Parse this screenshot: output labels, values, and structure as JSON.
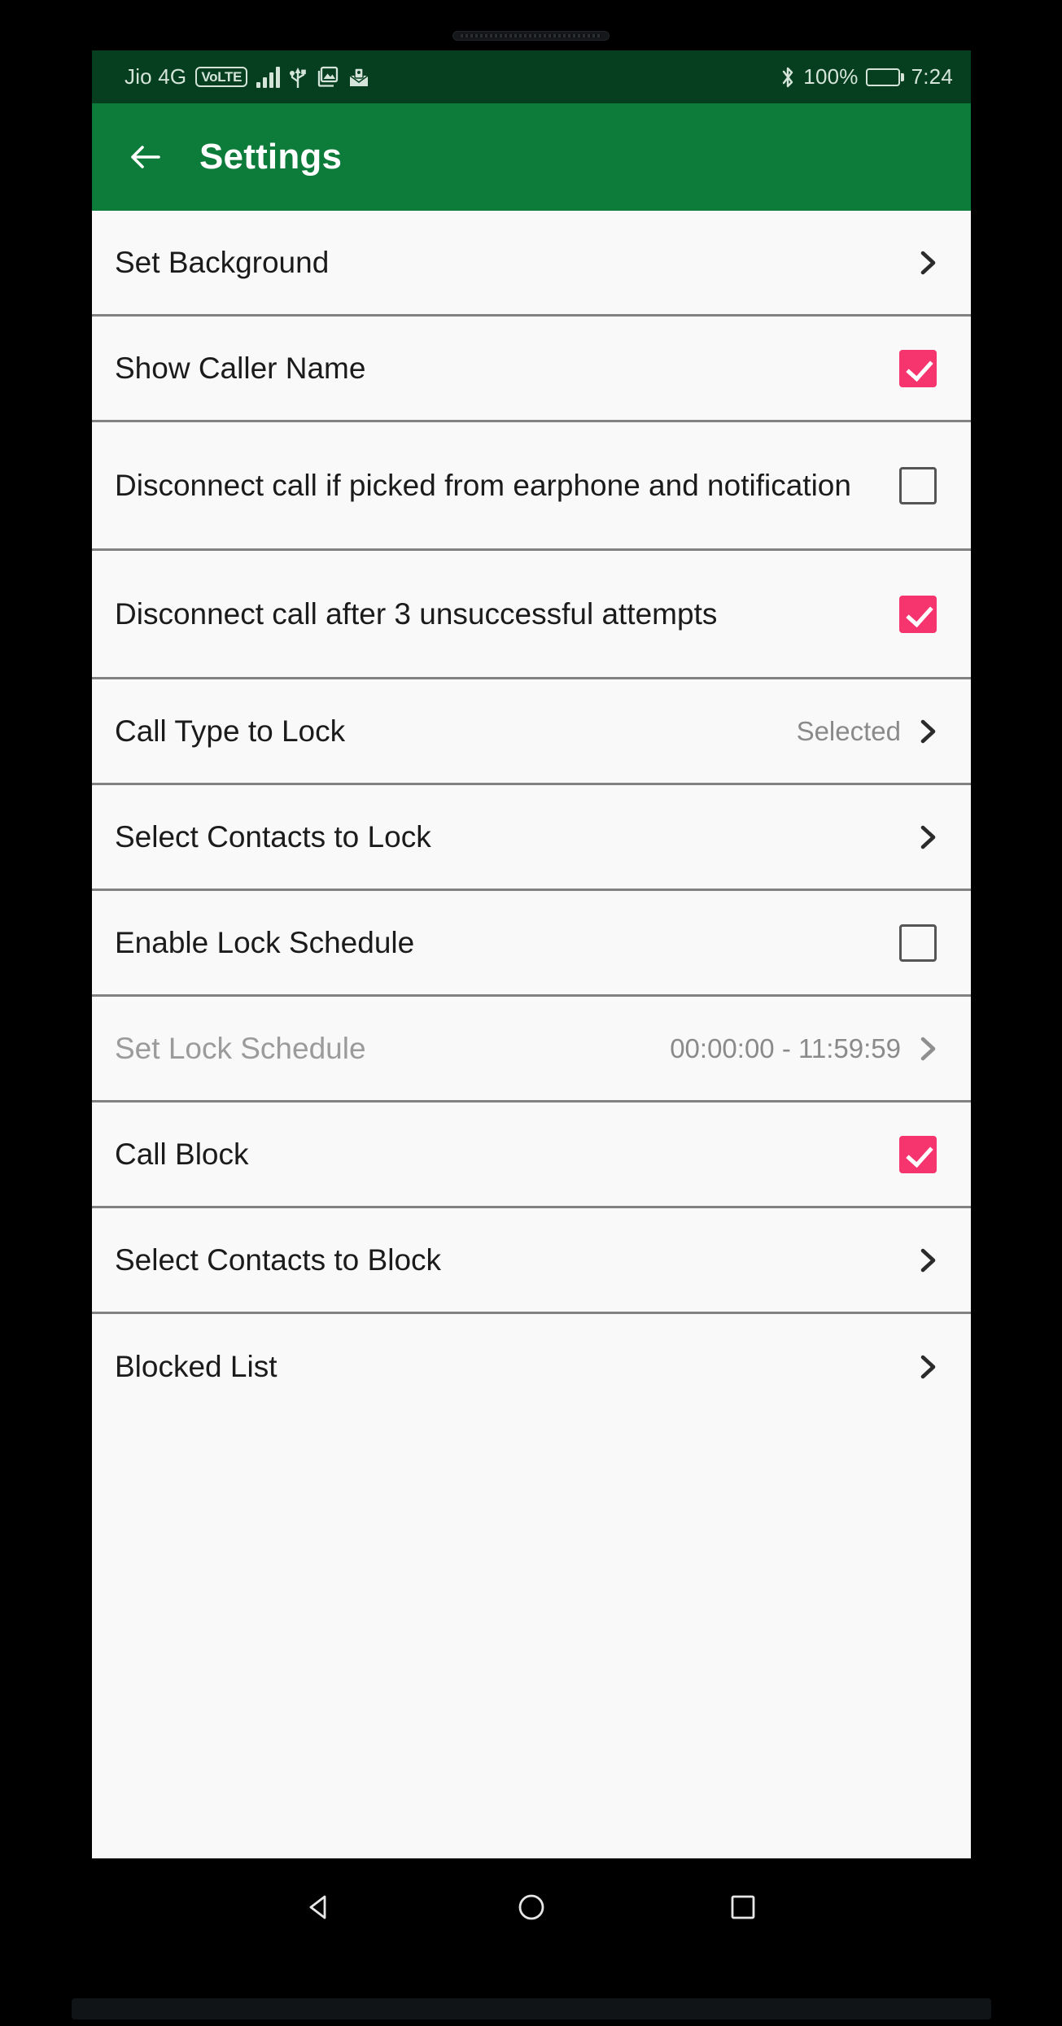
{
  "status_bar": {
    "carrier": "Jio 4G",
    "volte_badge": "VoLTE",
    "battery_percent": "100%",
    "time": "7:24",
    "icons": [
      "signal-bars-icon",
      "usb-icon",
      "gallery-icon",
      "mail-icon",
      "bluetooth-icon",
      "battery-icon"
    ],
    "background_color": "#053f20",
    "text_color": "#d5e4d9"
  },
  "app_bar": {
    "title": "Settings",
    "back_icon": "back-arrow-icon",
    "background_color": "#0d7c3b",
    "text_color": "#ffffff"
  },
  "theme": {
    "checkbox_checked_color": "#f6356f",
    "row_background": "#f9f9f9",
    "divider_color": "#828282",
    "disabled_text_color": "#9b9b9b"
  },
  "settings_rows": [
    {
      "label": "Set Background",
      "control": "chevron",
      "value": "",
      "checked": false,
      "disabled": false
    },
    {
      "label": "Show Caller Name",
      "control": "checkbox",
      "value": "",
      "checked": true,
      "disabled": false
    },
    {
      "label": "Disconnect call if picked from earphone and notification",
      "control": "checkbox",
      "value": "",
      "checked": false,
      "disabled": false
    },
    {
      "label": "Disconnect call after 3 unsuccessful attempts",
      "control": "checkbox",
      "value": "",
      "checked": true,
      "disabled": false
    },
    {
      "label": "Call Type to Lock",
      "control": "chevron",
      "value": "Selected",
      "checked": false,
      "disabled": false
    },
    {
      "label": "Select Contacts to Lock",
      "control": "chevron",
      "value": "",
      "checked": false,
      "disabled": false
    },
    {
      "label": "Enable Lock Schedule",
      "control": "checkbox",
      "value": "",
      "checked": false,
      "disabled": false
    },
    {
      "label": "Set Lock Schedule",
      "control": "chevron",
      "value": "00:00:00 - 11:59:59",
      "checked": false,
      "disabled": true
    },
    {
      "label": "Call Block",
      "control": "checkbox",
      "value": "",
      "checked": true,
      "disabled": false
    },
    {
      "label": "Select Contacts to Block",
      "control": "chevron",
      "value": "",
      "checked": false,
      "disabled": false
    },
    {
      "label": "Blocked List",
      "control": "chevron",
      "value": "",
      "checked": false,
      "disabled": false
    }
  ],
  "nav_bar": {
    "back": "nav-back-triangle-icon",
    "home": "nav-home-circle-icon",
    "recents": "nav-recents-square-icon"
  }
}
